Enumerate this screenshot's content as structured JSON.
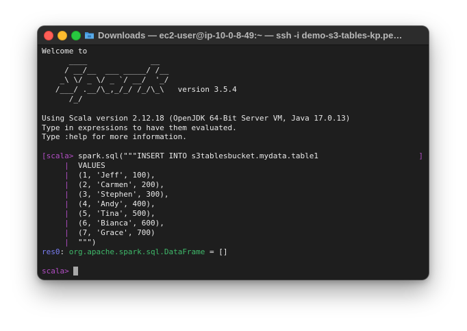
{
  "window": {
    "title": "Downloads — ec2-user@ip-10-0-8-49:~ — ssh -i demo-s3-tables-kp.pe…"
  },
  "terminal": {
    "welcome": "Welcome to",
    "banner": [
      "      ____              __",
      "     / __/__  ___ _____/ /__",
      "    _\\ \\/ _ \\/ _ `/ __/  '_/",
      "   /___/ .__/\\_,_/_/ /_/\\_\\   version 3.5.4",
      "      /_/"
    ],
    "info": [
      "Using Scala version 2.12.18 (OpenJDK 64-Bit Server VM, Java 17.0.13)",
      "Type in expressions to have them evaluated.",
      "Type :help for more information."
    ],
    "prompt_open": "[",
    "prompt": "scala>",
    "prompt_close": "]",
    "prompt_plain": "scala>",
    "command_first": " spark.sql(\"\"\"INSERT INTO s3tablesbucket.mydata.table1",
    "continuation_bar": "|",
    "command_rest": [
      "  VALUES",
      "  (1, 'Jeff', 100),",
      "  (2, 'Carmen', 200),",
      "  (3, 'Stephen', 300),",
      "  (4, 'Andy', 400),",
      "  (5, 'Tina', 500),",
      "  (6, 'Bianca', 600),",
      "  (7, 'Grace', 700)",
      "  \"\"\")"
    ],
    "result_name": "res0",
    "result_colon": ": ",
    "result_type": "org.apache.spark.sql.DataFrame",
    "result_value": " = []"
  },
  "colors": {
    "prompt": "#b24ec4",
    "result_name": "#7a7ef5",
    "result_type": "#3fb96a"
  },
  "icons": {
    "title_icon": "folder-icon"
  }
}
